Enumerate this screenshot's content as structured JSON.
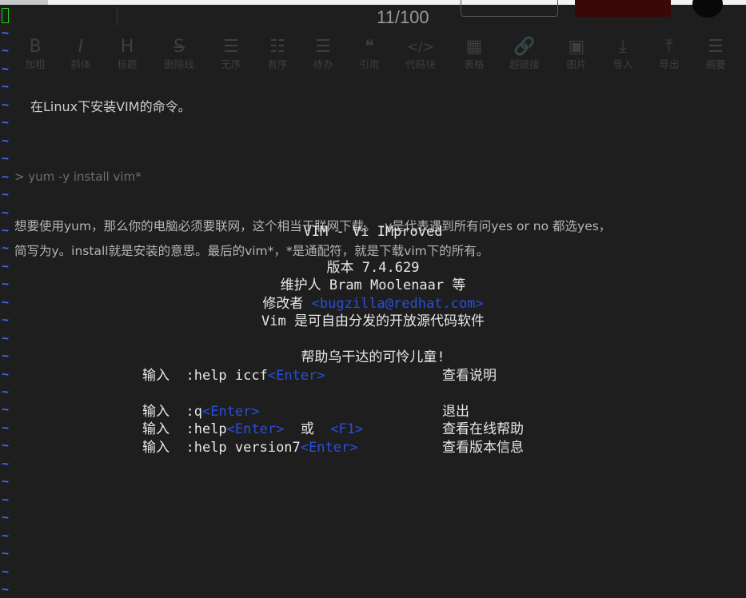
{
  "editor": {
    "counter": "11/100",
    "toolbar": [
      {
        "icon": "B",
        "label": "加粗",
        "name": "bold"
      },
      {
        "icon": "I",
        "label": "斜体",
        "name": "italic"
      },
      {
        "icon": "H",
        "label": "标题",
        "name": "heading"
      },
      {
        "icon": "S̶",
        "label": "删除线",
        "name": "strikethrough"
      },
      {
        "icon": "☰",
        "label": "无序",
        "name": "unordered-list"
      },
      {
        "icon": "☷",
        "label": "有序",
        "name": "ordered-list"
      },
      {
        "icon": "☰",
        "label": "待办",
        "name": "todo"
      },
      {
        "icon": "❝",
        "label": "引用",
        "name": "quote"
      },
      {
        "icon": "</>",
        "label": "代码块",
        "name": "code-block"
      },
      {
        "icon": "▦",
        "label": "表格",
        "name": "table"
      },
      {
        "icon": "🔗",
        "label": "超链接",
        "name": "link"
      },
      {
        "icon": "▣",
        "label": "图片",
        "name": "image"
      },
      {
        "icon": "⤓",
        "label": "导入",
        "name": "import"
      },
      {
        "icon": "⤒",
        "label": "导出",
        "name": "export"
      },
      {
        "icon": "☰",
        "label": "摘要",
        "name": "summary"
      }
    ],
    "article": {
      "line1": "在Linux下安装VIM的命令。",
      "line2": "> yum -y install vim*",
      "line3": "想要使用yum，那么你的电脑必须要联网，这个相当于联网下载。 -y是代表遇到所有问yes or no 都选yes，",
      "line4": "简写为y。install就是安装的意思。最后的vim*，*是通配符，就是下载vim下的所有。"
    }
  },
  "vim": {
    "title": "VIM - Vi IMproved",
    "version": "版本 7.4.629",
    "maintainer": "维护人 Bram Moolenaar 等",
    "modified_by_label": "修改者",
    "modified_by_email": "<bugzilla@redhat.com>",
    "license": "Vim 是可自由分发的开放源代码软件",
    "help_uganda": "帮助乌干达的可怜儿童!",
    "commands": [
      {
        "prefix": "输入",
        "cmd": ":help iccf",
        "key": "<Enter>",
        "desc": "查看说明"
      },
      {
        "prefix": "输入",
        "cmd": ":q",
        "key": "<Enter>",
        "desc": "退出"
      },
      {
        "prefix": "输入",
        "cmd": ":help",
        "key": "<Enter>",
        "or": "或",
        "key2": "<F1>",
        "desc": "查看在线帮助"
      },
      {
        "prefix": "输入",
        "cmd": ":help version7",
        "key": "<Enter>",
        "desc": "查看版本信息"
      }
    ],
    "tilde": "~"
  },
  "colors": {
    "background": "#1e1e1e",
    "tilde": "#3b6cff",
    "key": "#2a4fd8",
    "cursor": "#20d020"
  }
}
